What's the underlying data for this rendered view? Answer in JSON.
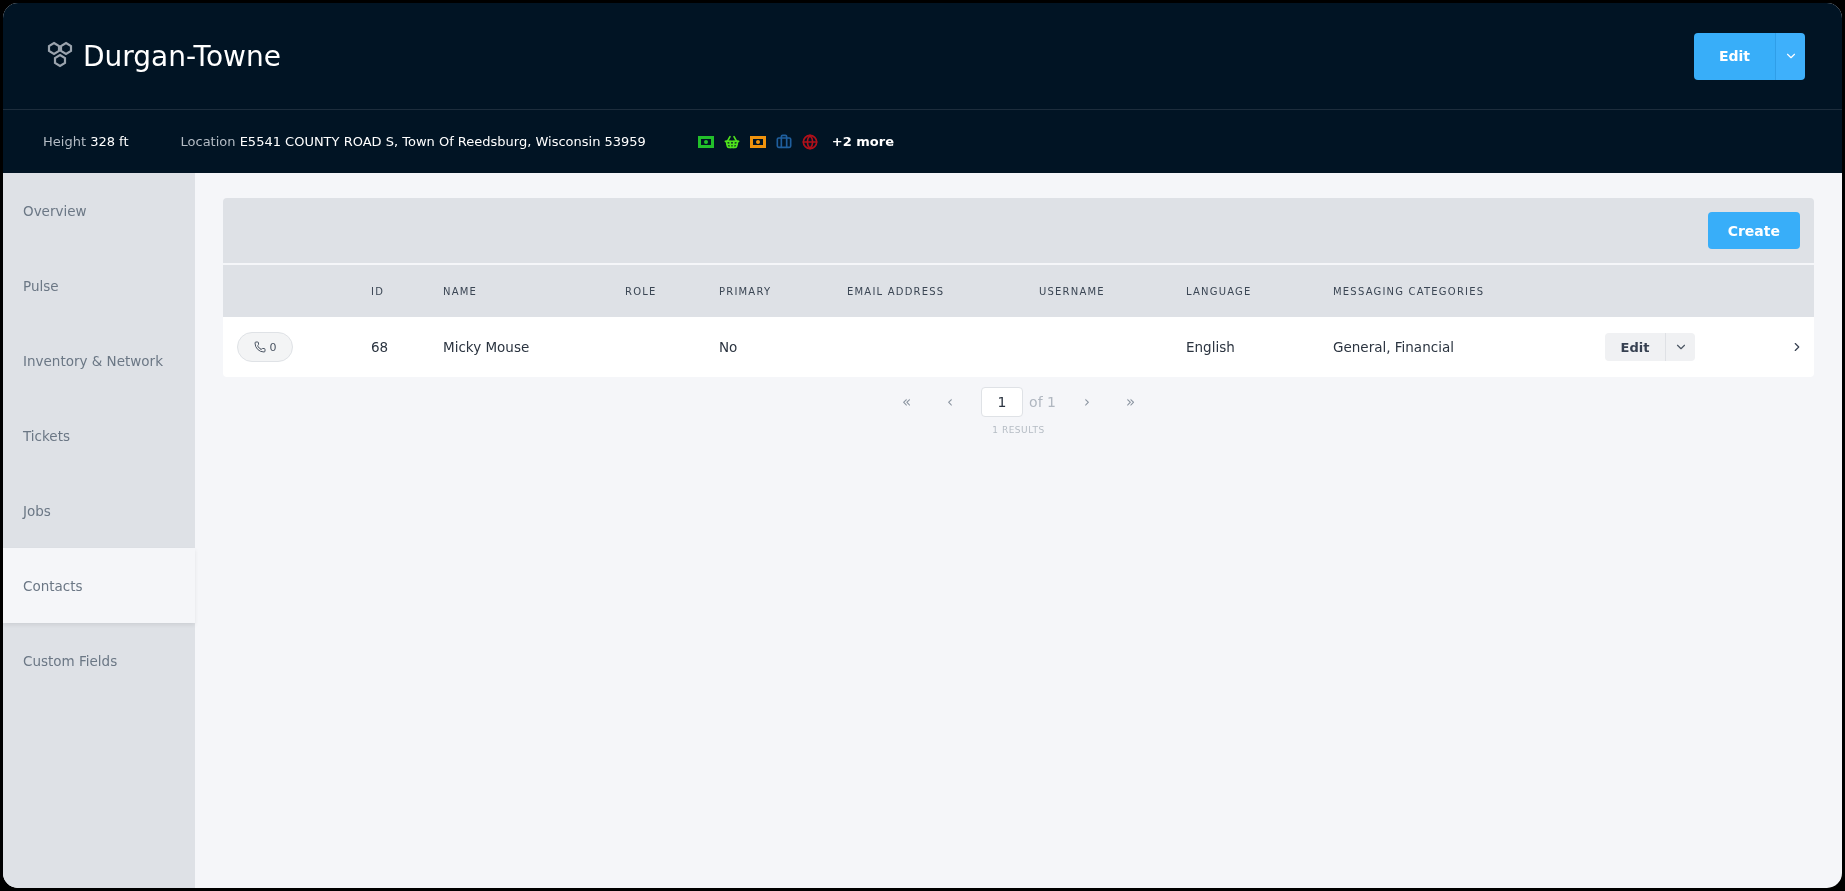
{
  "header": {
    "title": "Durgan-Towne",
    "edit_button": "Edit"
  },
  "info": [
    {
      "label": "Height",
      "value": "328 ft"
    },
    {
      "label": "Location",
      "value": "E5541 COUNTY ROAD S, Town Of Reedsburg, Wisconsin 53959"
    }
  ],
  "status_icons": [
    {
      "kind": "money",
      "color": "#22c02a"
    },
    {
      "kind": "basket",
      "color": "#4fe31c"
    },
    {
      "kind": "money",
      "color": "#f0930d"
    },
    {
      "kind": "briefcase",
      "color": "#1f5f9e"
    },
    {
      "kind": "globe",
      "color": "#b0101a"
    }
  ],
  "more": "+2 more",
  "sidebar": {
    "items": [
      {
        "label": "Overview",
        "selected": false
      },
      {
        "label": "Pulse",
        "selected": false
      },
      {
        "label": "Inventory & Network",
        "selected": false
      },
      {
        "label": "Tickets",
        "selected": false
      },
      {
        "label": "Jobs",
        "selected": false
      },
      {
        "label": "Contacts",
        "selected": true
      },
      {
        "label": "Custom Fields",
        "selected": false
      }
    ]
  },
  "toolbar": {
    "create_button": "Create"
  },
  "table": {
    "columns": [
      "ID",
      "NAME",
      "ROLE",
      "PRIMARY",
      "EMAIL ADDRESS",
      "USERNAME",
      "LANGUAGE",
      "MESSAGING CATEGORIES"
    ],
    "rows": [
      {
        "calls": "0",
        "cells": [
          "68",
          "Micky Mouse",
          "",
          "No",
          "",
          "",
          "English",
          "General, Financial"
        ],
        "action": "Edit"
      }
    ]
  },
  "pagination": {
    "first": "«",
    "prev": "‹",
    "page": "1",
    "of": "of 1",
    "next": "›",
    "last": "»",
    "results": "1 RESULTS"
  }
}
